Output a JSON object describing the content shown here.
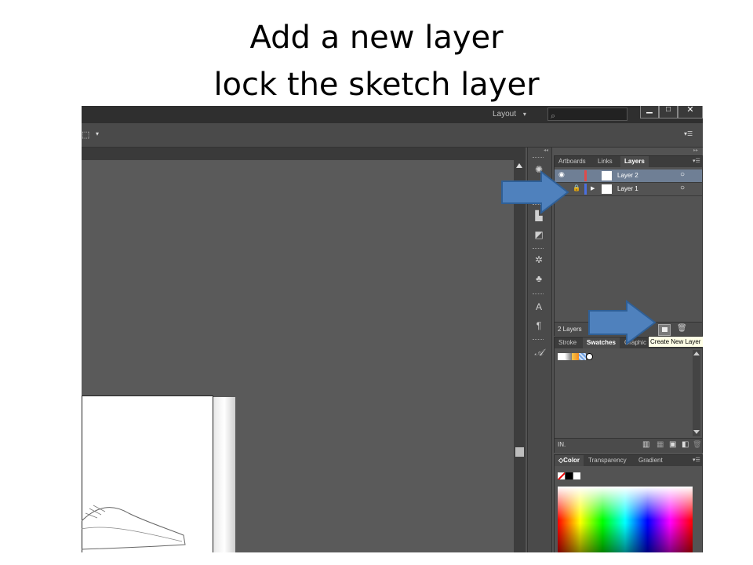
{
  "slide": {
    "title_line1": "Add a new layer",
    "title_line2": "lock the sketch layer"
  },
  "app": {
    "workspace_label": "Layout",
    "workspace_arrow": "▾",
    "window_controls": {
      "minimize": "▁",
      "maximize": "□",
      "close": "✕"
    },
    "control_bar": {
      "tool_glyph": "⬚",
      "tool_arrow": "▾",
      "panel_menu": "▾☰"
    },
    "collapse_left": "◂◂",
    "collapse_right": "▸▸"
  },
  "layers_panel": {
    "tabs": [
      {
        "label": "Artboards",
        "active": false
      },
      {
        "label": "Links",
        "active": false
      },
      {
        "label": "Layers",
        "active": true
      }
    ],
    "menu_glyph": "▾☰",
    "layers": [
      {
        "name": "Layer 2",
        "visible_glyph": "◉",
        "lock_glyph": "",
        "expand_glyph": "",
        "color": "#e04a4a",
        "target_glyph": "○",
        "selected": true
      },
      {
        "name": "Layer 1",
        "visible_glyph": "",
        "lock_glyph": "🔒",
        "expand_glyph": "▶",
        "color": "#4a6fe0",
        "target_glyph": "○",
        "selected": false
      }
    ],
    "footer_count": "2 Layers",
    "tooltip": "Create New Layer"
  },
  "swatches_panel": {
    "tabs": [
      {
        "label": "Stroke",
        "active": false
      },
      {
        "label": "Swatches",
        "active": true
      },
      {
        "label": "Graphic Styles",
        "active": false
      }
    ],
    "library_glyph": "IN.",
    "footer_icons": [
      "▥",
      "▦",
      "▣",
      "◧",
      "🗑"
    ]
  },
  "color_panel": {
    "tabs": [
      {
        "label": "◇Color",
        "active": true
      },
      {
        "label": "Transparency",
        "active": false
      },
      {
        "label": "Gradient",
        "active": false
      }
    ],
    "menu_glyph": "▾☰"
  },
  "colors": {
    "arrow_fill": "#4f81bd",
    "arrow_stroke": "#2f5f96",
    "panel_bg": "#535353",
    "canvas_bg": "#5a5a5a"
  },
  "search_icon": "⌕"
}
